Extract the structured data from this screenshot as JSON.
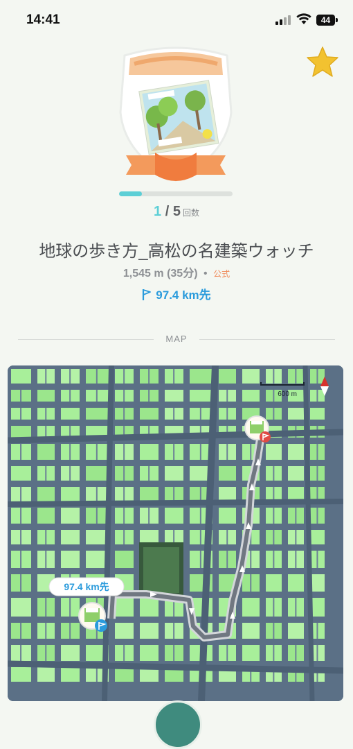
{
  "status_bar": {
    "time": "14:41",
    "battery": "44"
  },
  "route": {
    "progress_current": "1",
    "progress_separator": " / ",
    "progress_total": "5",
    "progress_unit": "回数",
    "progress_fraction": 0.2,
    "title": "地球の歩き方_高松の名建築ウォッチ",
    "length": "1,545 m",
    "duration": "(35分)",
    "separator": "•",
    "official_label": "公式",
    "distance_away": "97.4 km先"
  },
  "map_section": {
    "heading": "MAP",
    "scale_label": "600 m",
    "distance_callout": "97.4 km先"
  },
  "colors": {
    "accent_teal": "#5ccfd6",
    "distance_blue": "#2a9bdc",
    "official_orange": "#f08a5a",
    "star_gold": "#f2c230",
    "park_green": "#a8ef9a",
    "road_slate": "#5b7086"
  }
}
